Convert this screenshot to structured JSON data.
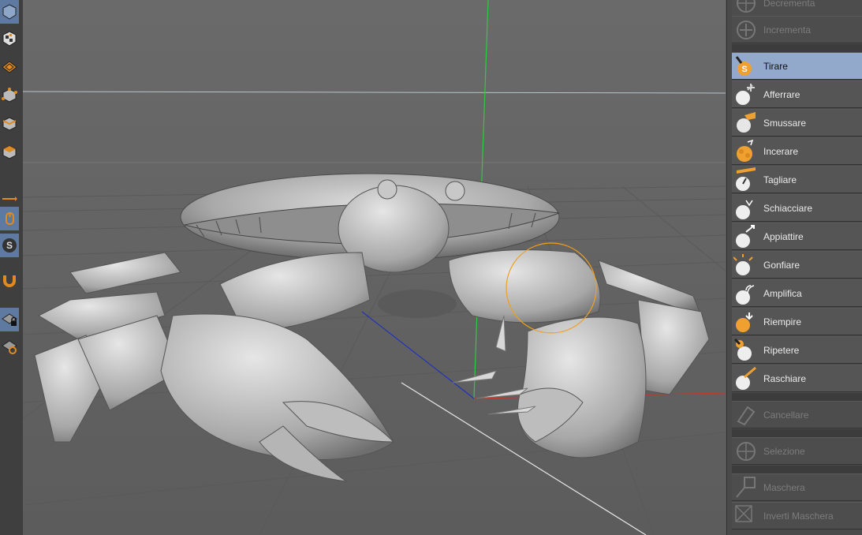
{
  "left_toolbar": {
    "buttons": [
      {
        "id": "cube-blue",
        "icon": "cube-icon"
      },
      {
        "id": "checker",
        "icon": "checker-material-icon"
      },
      {
        "id": "texture",
        "icon": "texture-mode-icon"
      },
      {
        "id": "points",
        "icon": "points-mode-icon"
      },
      {
        "id": "edges",
        "icon": "edges-mode-icon"
      },
      {
        "id": "polygons",
        "icon": "polygons-mode-icon"
      },
      {
        "id": "axis",
        "icon": "axis-arrow-icon"
      },
      {
        "id": "mouse",
        "icon": "mouse-icon"
      },
      {
        "id": "sculpt",
        "icon": "sculpt-s-icon"
      },
      {
        "id": "magnet",
        "icon": "magnet-icon"
      },
      {
        "id": "lock",
        "icon": "lock-grid-icon"
      },
      {
        "id": "refresh",
        "icon": "refresh-grid-icon"
      }
    ]
  },
  "viewport": {
    "axis_colors": {
      "x": "#c0392b",
      "y": "#2ecc40",
      "z": "#2233bb"
    },
    "brush_color": "#f0a020"
  },
  "tools": [
    {
      "label": "Decrementa",
      "state": "disabled",
      "icon": "decrement-icon"
    },
    {
      "label": "Incrementa",
      "state": "disabled",
      "icon": "increment-icon"
    },
    {
      "label": "Tirare",
      "state": "active",
      "icon": "pull-brush-icon"
    },
    {
      "label": "Afferrare",
      "state": "normal",
      "icon": "grab-brush-icon"
    },
    {
      "label": "Smussare",
      "state": "normal",
      "icon": "smooth-brush-icon"
    },
    {
      "label": "Incerare",
      "state": "normal",
      "icon": "wax-brush-icon"
    },
    {
      "label": "Tagliare",
      "state": "normal",
      "icon": "flatten-cut-brush-icon"
    },
    {
      "label": "Schiacciare",
      "state": "normal",
      "icon": "pinch-brush-icon"
    },
    {
      "label": "Appiattire",
      "state": "normal",
      "icon": "flatten-brush-icon"
    },
    {
      "label": "Gonfiare",
      "state": "normal",
      "icon": "inflate-brush-icon"
    },
    {
      "label": "Amplifica",
      "state": "normal",
      "icon": "amplify-brush-icon"
    },
    {
      "label": "Riempire",
      "state": "normal",
      "icon": "fill-brush-icon"
    },
    {
      "label": "Ripetere",
      "state": "normal",
      "icon": "repeat-brush-icon"
    },
    {
      "label": "Raschiare",
      "state": "normal",
      "icon": "scrape-brush-icon"
    },
    {
      "label": "Cancellare",
      "state": "disabled",
      "icon": "erase-icon"
    },
    {
      "label": "Selezione",
      "state": "disabled",
      "icon": "select-icon"
    },
    {
      "label": "Maschera",
      "state": "disabled",
      "icon": "mask-icon"
    },
    {
      "label": "Inverti Maschera",
      "state": "disabled",
      "icon": "invert-mask-icon"
    }
  ]
}
